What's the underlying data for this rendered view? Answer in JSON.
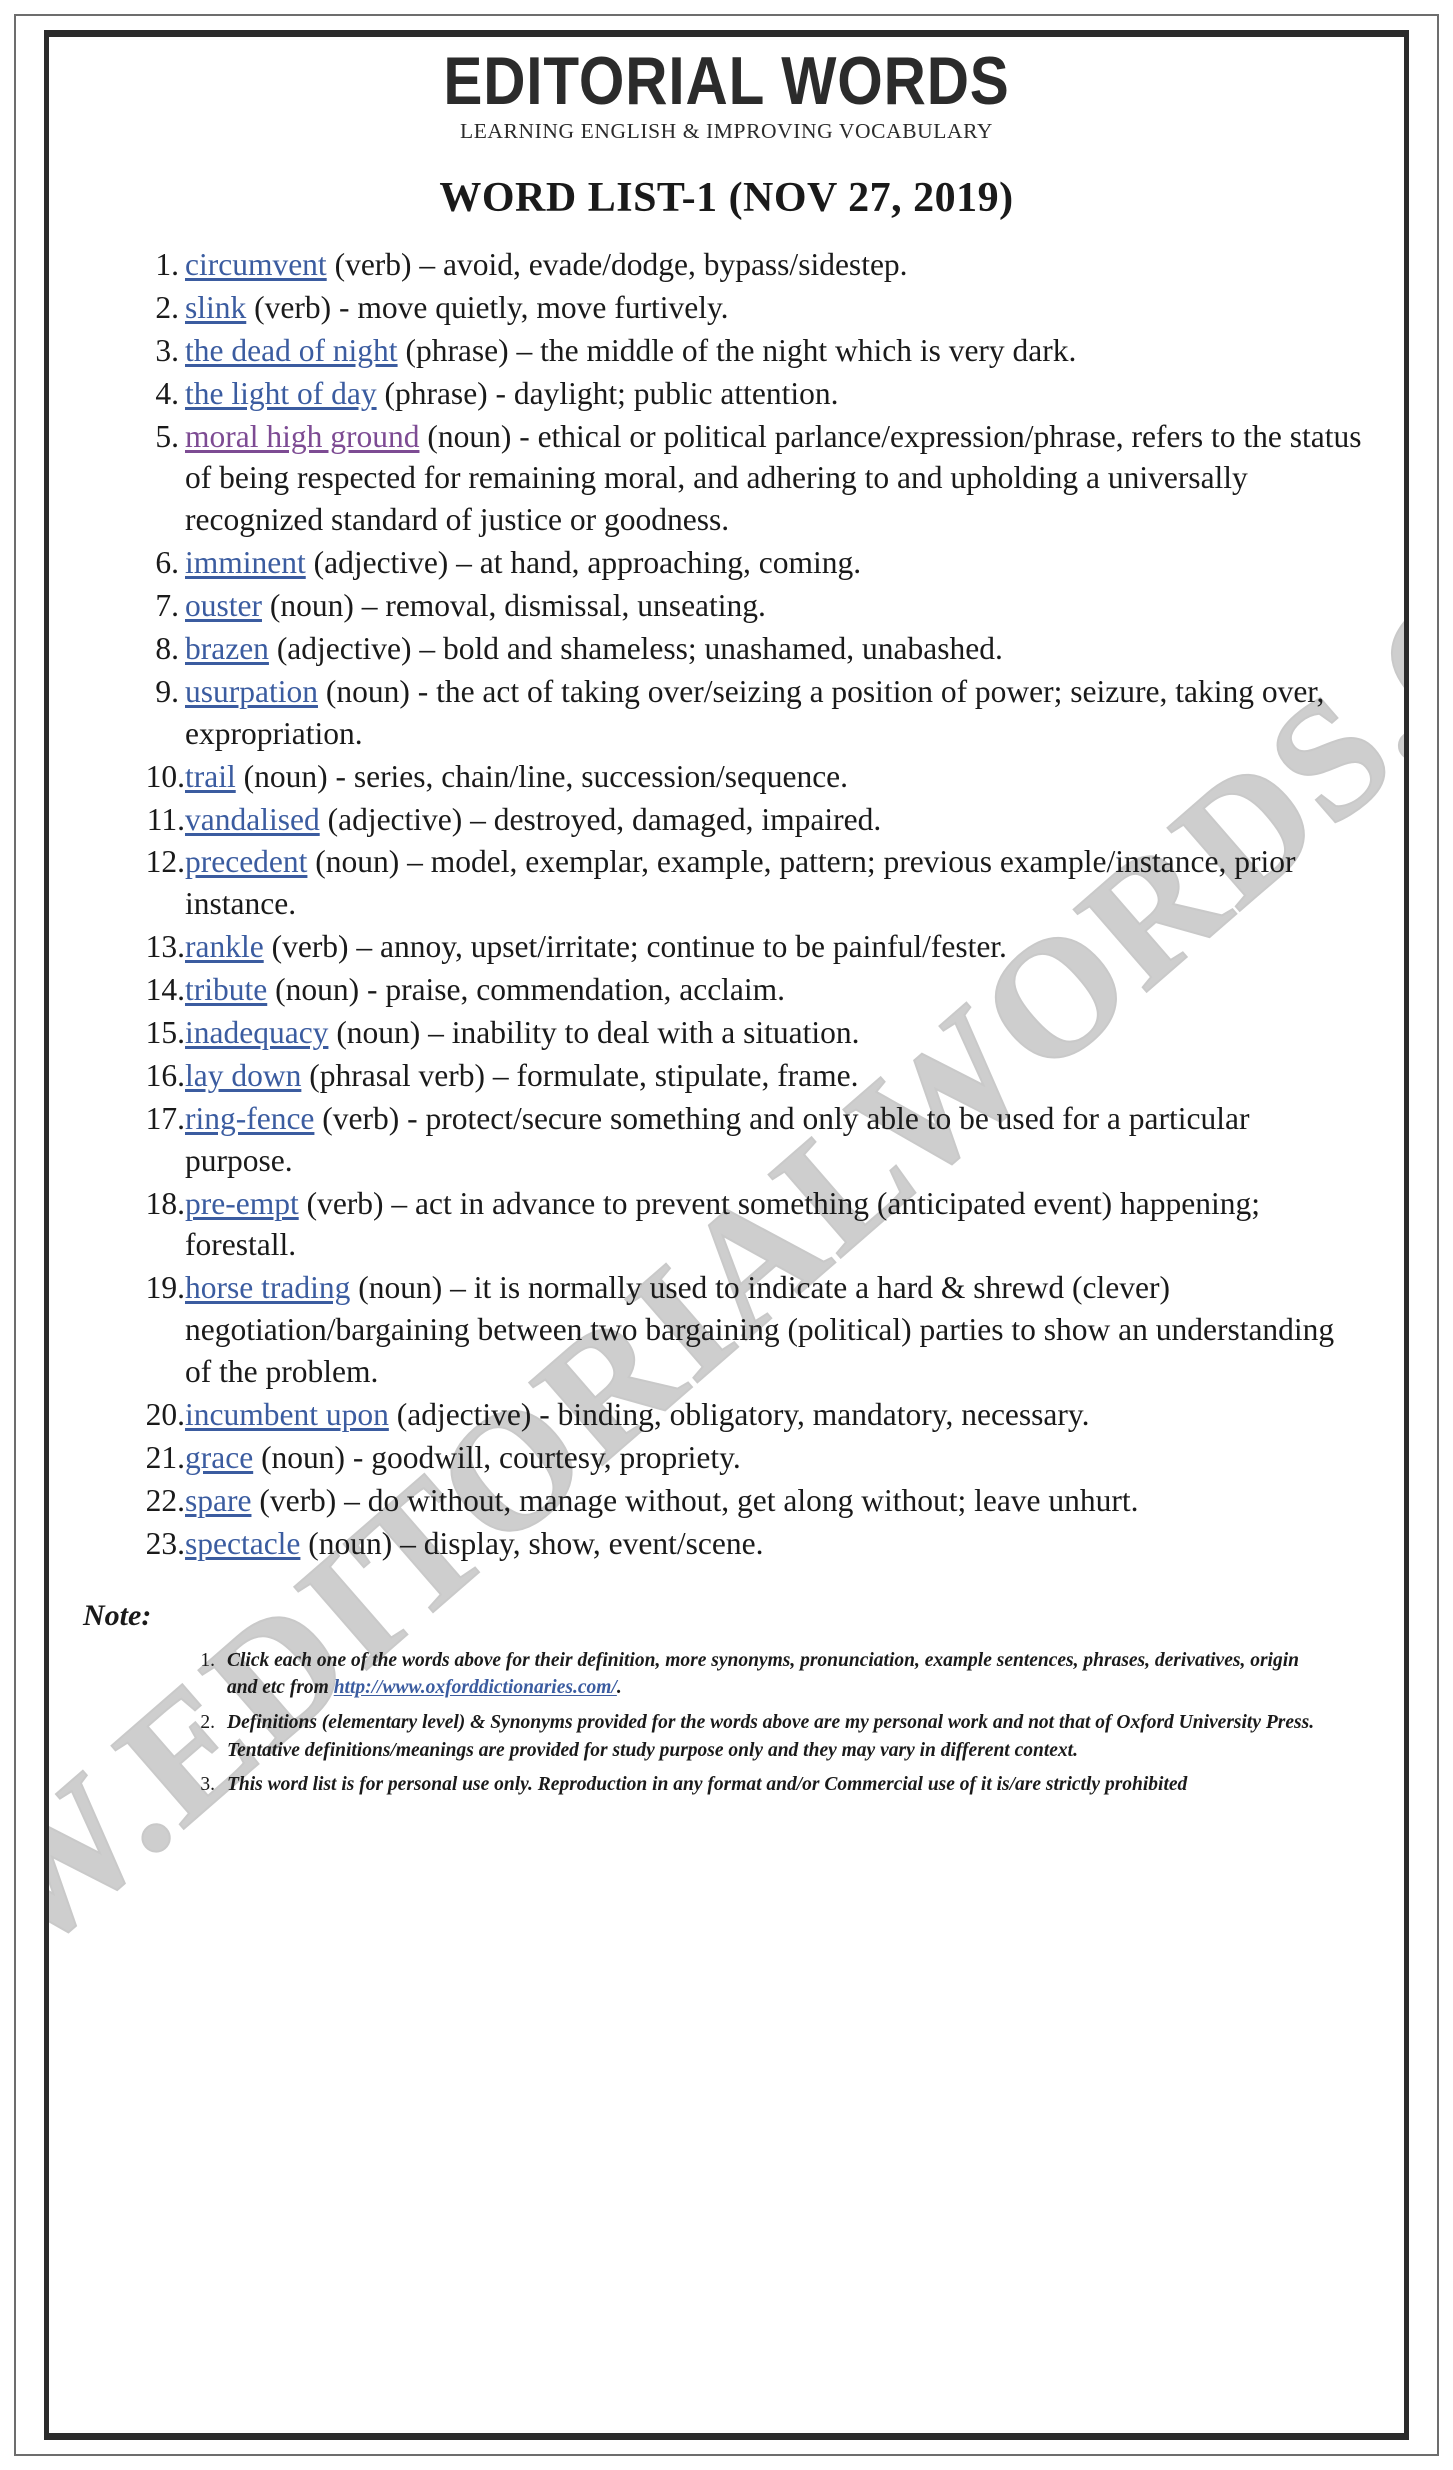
{
  "masthead": {
    "brand": "EDITORIAL WORDS",
    "tagline": "LEARNING ENGLISH & IMPROVING VOCABULARY"
  },
  "page_title": "WORD LIST-1 (NOV 27, 2019)",
  "watermark": "WWW.EDITORIALWORDS.COM",
  "colors": {
    "link_blue": "#3b5ca0",
    "link_purple": "#7d4b93",
    "rule_dark": "#2b2b2b",
    "watermark_gray": "#c6c6c6"
  },
  "words": [
    {
      "n": "1.",
      "term": "circumvent",
      "color": "blue",
      "rest": " (verb) – avoid, evade/dodge, bypass/sidestep."
    },
    {
      "n": "2.",
      "term": "slink",
      "color": "blue",
      "rest": " (verb) - move quietly, move furtively."
    },
    {
      "n": "3.",
      "term": "the dead of night",
      "color": "blue",
      "rest": " (phrase) – the middle of the night which is very dark."
    },
    {
      "n": "4.",
      "term": "the light of day",
      "color": "blue",
      "rest": " (phrase) - daylight; public attention."
    },
    {
      "n": "5.",
      "term": "moral high ground",
      "color": "purple",
      "rest": " (noun) - ethical or political parlance/expression/phrase, refers to the status of being respected for remaining moral, and adhering to and upholding a universally recognized standard of justice or goodness."
    },
    {
      "n": "6.",
      "term": "imminent",
      "color": "blue",
      "rest": " (adjective) – at hand, approaching, coming."
    },
    {
      "n": "7.",
      "term": "ouster",
      "color": "blue",
      "rest": " (noun) – removal, dismissal, unseating."
    },
    {
      "n": "8.",
      "term": "brazen",
      "color": "blue",
      "rest": " (adjective) – bold and shameless; unashamed, unabashed."
    },
    {
      "n": "9.",
      "term": "usurpation",
      "color": "blue",
      "rest": " (noun) - the act of taking over/seizing a position of power; seizure, taking over, expropriation."
    },
    {
      "n": "10.",
      "term": "trail",
      "color": "blue",
      "rest": " (noun) - series, chain/line, succession/sequence."
    },
    {
      "n": "11.",
      "term": "vandalised",
      "color": "blue",
      "rest": " (adjective) – destroyed, damaged, impaired."
    },
    {
      "n": "12.",
      "term": "precedent",
      "color": "blue",
      "rest": " (noun) – model, exemplar, example, pattern; previous example/instance, prior instance."
    },
    {
      "n": "13.",
      "term": "rankle",
      "color": "blue",
      "rest": " (verb) – annoy, upset/irritate; continue to be painful/fester."
    },
    {
      "n": "14.",
      "term": "tribute",
      "color": "blue",
      "rest": " (noun) - praise, commendation, acclaim."
    },
    {
      "n": "15.",
      "term": "inadequacy",
      "color": "blue",
      "rest": " (noun) – inability to deal with a situation."
    },
    {
      "n": "16.",
      "term": "lay down",
      "color": "blue",
      "rest": " (phrasal verb) – formulate, stipulate, frame."
    },
    {
      "n": "17.",
      "term": "ring-fence",
      "color": "blue",
      "rest": " (verb) - protect/secure something and only able to be used for a particular purpose."
    },
    {
      "n": "18.",
      "term": "pre-empt",
      "color": "blue",
      "rest": " (verb) – act in advance to prevent something (anticipated event) happening; forestall."
    },
    {
      "n": "19.",
      "term": "horse trading",
      "color": "blue",
      "rest": " (noun) – it is normally used to indicate a hard & shrewd (clever) negotiation/bargaining between two bargaining (political) parties to show an understanding of the problem."
    },
    {
      "n": "20.",
      "term": "incumbent upon",
      "color": "blue",
      "rest": " (adjective) - binding, obligatory, mandatory, necessary."
    },
    {
      "n": "21.",
      "term": "grace",
      "color": "blue",
      "rest": " (noun) - goodwill, courtesy, propriety."
    },
    {
      "n": "22.",
      "term": "spare",
      "color": "blue",
      "rest": " (verb) – do without, manage without, get along without; leave unhurt."
    },
    {
      "n": "23.",
      "term": "spectacle",
      "color": "blue",
      "rest": " (noun) – display, show, event/scene."
    }
  ],
  "note": {
    "label": "Note:",
    "items": [
      {
        "n": "1.",
        "before": "Click each one of the words above for their definition, more synonyms, pronunciation, example sentences, phrases, derivatives, origin and etc from ",
        "link": "http://www.oxforddictionaries.com/",
        "after": "."
      },
      {
        "n": "2.",
        "before": "Definitions (elementary level) & Synonyms provided for the words above are my personal work and not that of Oxford University Press. Tentative definitions/meanings are provided for study purpose only and they may vary in different context.",
        "link": "",
        "after": ""
      },
      {
        "n": "3.",
        "before": "This word list is for personal use only. Reproduction in any format and/or Commercial use of it is/are strictly prohibited",
        "link": "",
        "after": ""
      }
    ]
  }
}
